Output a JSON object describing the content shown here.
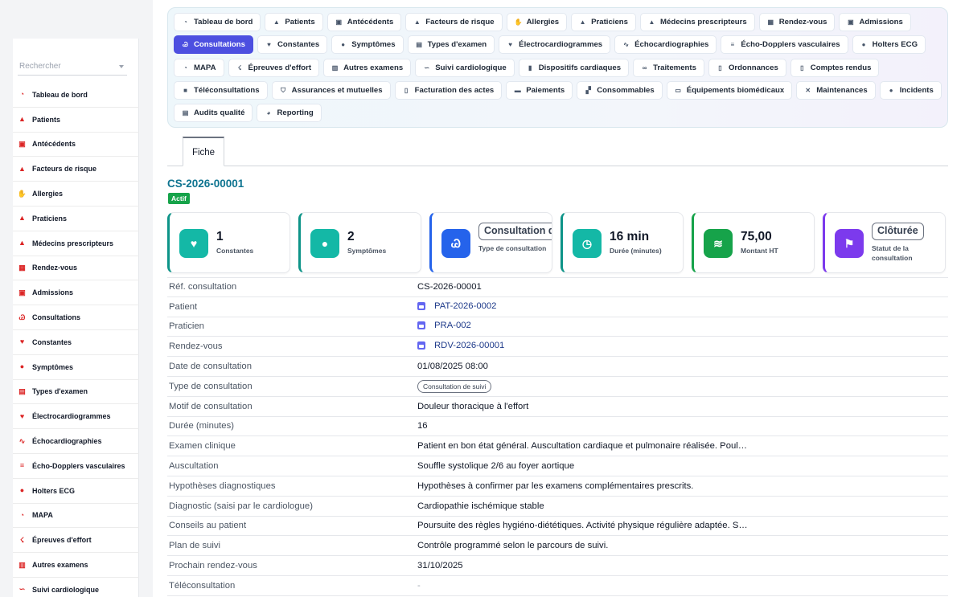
{
  "search": {
    "placeholder": "Rechercher"
  },
  "sidebar": {
    "items": [
      {
        "label": "Tableau de bord",
        "icon": "dashboard-icon",
        "glyph": "◔"
      },
      {
        "label": "Patients",
        "icon": "user-icon",
        "glyph": "▲"
      },
      {
        "label": "Antécédents",
        "icon": "clipboard-icon",
        "glyph": "▣"
      },
      {
        "label": "Facteurs de risque",
        "icon": "warning-icon",
        "glyph": "▲"
      },
      {
        "label": "Allergies",
        "icon": "hand-icon",
        "glyph": "✋"
      },
      {
        "label": "Praticiens",
        "icon": "doctor-icon",
        "glyph": "▲"
      },
      {
        "label": "Médecins prescripteurs",
        "icon": "doctor-icon",
        "glyph": "▲"
      },
      {
        "label": "Rendez-vous",
        "icon": "calendar-icon",
        "glyph": "▦"
      },
      {
        "label": "Admissions",
        "icon": "clipboard-check-icon",
        "glyph": "▣"
      },
      {
        "label": "Consultations",
        "icon": "stethoscope-icon",
        "glyph": "Ꮚ"
      },
      {
        "label": "Constantes",
        "icon": "heart-pulse-icon",
        "glyph": "♥"
      },
      {
        "label": "Symptômes",
        "icon": "head-icon",
        "glyph": "●"
      },
      {
        "label": "Types d'examen",
        "icon": "list-icon",
        "glyph": "▤"
      },
      {
        "label": "Électrocardiogrammes",
        "icon": "heart-icon",
        "glyph": "♥"
      },
      {
        "label": "Échocardiographies",
        "icon": "wave-icon",
        "glyph": "∿"
      },
      {
        "label": "Écho-Dopplers vasculaires",
        "icon": "lines-icon",
        "glyph": "≡"
      },
      {
        "label": "Holters ECG",
        "icon": "clock-icon",
        "glyph": "●"
      },
      {
        "label": "MAPA",
        "icon": "gauge-icon",
        "glyph": "◔"
      },
      {
        "label": "Épreuves d'effort",
        "icon": "running-icon",
        "glyph": "☇"
      },
      {
        "label": "Autres examens",
        "icon": "building-icon",
        "glyph": "▥"
      },
      {
        "label": "Suivi cardiologique",
        "icon": "route-icon",
        "glyph": "∽"
      }
    ]
  },
  "nav": {
    "buttons": [
      {
        "label": "Tableau de bord",
        "icon": "dashboard-icon",
        "glyph": "◔"
      },
      {
        "label": "Patients",
        "icon": "user-icon",
        "glyph": "▲"
      },
      {
        "label": "Antécédents",
        "icon": "clipboard-icon",
        "glyph": "▣"
      },
      {
        "label": "Facteurs de risque",
        "icon": "warning-icon",
        "glyph": "▲"
      },
      {
        "label": "Allergies",
        "icon": "hand-icon",
        "glyph": "✋"
      },
      {
        "label": "Praticiens",
        "icon": "doctor-icon",
        "glyph": "▲"
      },
      {
        "label": "Médecins prescripteurs",
        "icon": "doctor-icon",
        "glyph": "▲"
      },
      {
        "label": "Rendez-vous",
        "icon": "calendar-icon",
        "glyph": "▦"
      },
      {
        "label": "Admissions",
        "icon": "clipboard-check-icon",
        "glyph": "▣"
      },
      {
        "label": "Consultations",
        "icon": "stethoscope-icon",
        "glyph": "Ꮚ",
        "active": true
      },
      {
        "label": "Constantes",
        "icon": "heart-pulse-icon",
        "glyph": "♥"
      },
      {
        "label": "Symptômes",
        "icon": "head-icon",
        "glyph": "●"
      },
      {
        "label": "Types d'examen",
        "icon": "list-icon",
        "glyph": "▤"
      },
      {
        "label": "Électrocardiogrammes",
        "icon": "heart-icon",
        "glyph": "♥"
      },
      {
        "label": "Échocardiographies",
        "icon": "wave-icon",
        "glyph": "∿"
      },
      {
        "label": "Écho-Dopplers vasculaires",
        "icon": "lines-icon",
        "glyph": "≡"
      },
      {
        "label": "Holters ECG",
        "icon": "clock-icon",
        "glyph": "●"
      },
      {
        "label": "MAPA",
        "icon": "gauge-icon",
        "glyph": "◔"
      },
      {
        "label": "Épreuves d'effort",
        "icon": "running-icon",
        "glyph": "☇"
      },
      {
        "label": "Autres examens",
        "icon": "building-icon",
        "glyph": "▥"
      },
      {
        "label": "Suivi cardiologique",
        "icon": "route-icon",
        "glyph": "∽"
      },
      {
        "label": "Dispositifs cardiaques",
        "icon": "device-icon",
        "glyph": "▮"
      },
      {
        "label": "Traitements",
        "icon": "pills-icon",
        "glyph": "∞"
      },
      {
        "label": "Ordonnances",
        "icon": "prescription-icon",
        "glyph": "▯"
      },
      {
        "label": "Comptes rendus",
        "icon": "document-icon",
        "glyph": "▯"
      },
      {
        "label": "Téléconsultations",
        "icon": "video-icon",
        "glyph": "■"
      },
      {
        "label": "Assurances et mutuelles",
        "icon": "shield-icon",
        "glyph": "⛉"
      },
      {
        "label": "Facturation des actes",
        "icon": "invoice-icon",
        "glyph": "▯"
      },
      {
        "label": "Paiements",
        "icon": "card-icon",
        "glyph": "▬"
      },
      {
        "label": "Consommables",
        "icon": "boxes-icon",
        "glyph": "▞"
      },
      {
        "label": "Équipements biomédicaux",
        "icon": "monitor-icon",
        "glyph": "▭"
      },
      {
        "label": "Maintenances",
        "icon": "tools-icon",
        "glyph": "✕"
      },
      {
        "label": "Incidents",
        "icon": "alert-circle-icon",
        "glyph": "●"
      },
      {
        "label": "Audits qualité",
        "icon": "clipboard-list-icon",
        "glyph": "▤"
      },
      {
        "label": "Reporting",
        "icon": "pie-chart-icon",
        "glyph": "◕"
      }
    ]
  },
  "tabs": {
    "fiche": "Fiche"
  },
  "record": {
    "id": "CS-2026-00001",
    "status": "Actif"
  },
  "stats": [
    {
      "value": "1",
      "label": "Constantes",
      "icon": "heart-pulse-icon",
      "glyph": "♥",
      "color": "#14b8a6",
      "accent": "#0d9488"
    },
    {
      "value": "2",
      "label": "Symptômes",
      "icon": "head-icon",
      "glyph": "●",
      "color": "#14b8a6",
      "accent": "#0d9488"
    },
    {
      "value": "Consultation de suivi",
      "label": "Type de consultation",
      "icon": "stethoscope-icon",
      "glyph": "Ꮚ",
      "color": "#2563eb",
      "accent": "#2563eb",
      "boxed": true
    },
    {
      "value": "16 min",
      "label": "Durée (minutes)",
      "icon": "clock-icon",
      "glyph": "◷",
      "color": "#14b8a6",
      "accent": "#0d9488"
    },
    {
      "value": "75,00",
      "label": "Montant HT",
      "icon": "coins-icon",
      "glyph": "≋",
      "color": "#16a34a",
      "accent": "#16a34a"
    },
    {
      "value": "Clôturée",
      "label": "Statut de la consultation",
      "icon": "flag-icon",
      "glyph": "⚑",
      "color": "#7c3aed",
      "accent": "#7c3aed",
      "boxed": true
    }
  ],
  "details": [
    {
      "label": "Réf. consultation",
      "value": "CS-2026-00001"
    },
    {
      "label": "Patient",
      "value": "PAT-2026-0002",
      "link": true
    },
    {
      "label": "Praticien",
      "value": "PRA-002",
      "link": true
    },
    {
      "label": "Rendez-vous",
      "value": "RDV-2026-00001",
      "link": true
    },
    {
      "label": "Date de consultation",
      "value": "01/08/2025 08:00"
    },
    {
      "label": "Type de consultation",
      "value": "Consultation de suivi",
      "chip": true
    },
    {
      "label": "Motif de consultation",
      "value": "Douleur thoracique à l'effort"
    },
    {
      "label": "Durée (minutes)",
      "value": "16"
    },
    {
      "label": "Examen clinique",
      "value": "Patient en bon état général. Auscultation cardiaque et pulmonaire réalisée. Poul…"
    },
    {
      "label": "Auscultation",
      "value": "Souffle systolique 2/6 au foyer aortique"
    },
    {
      "label": "Hypothèses diagnostiques",
      "value": "Hypothèses à confirmer par les examens complémentaires prescrits."
    },
    {
      "label": "Diagnostic (saisi par le cardiologue)",
      "value": "Cardiopathie ischémique stable"
    },
    {
      "label": "Conseils au patient",
      "value": "Poursuite des règles hygiéno-diététiques. Activité physique régulière adaptée. S…"
    },
    {
      "label": "Plan de suivi",
      "value": "Contrôle programmé selon le parcours de suivi."
    },
    {
      "label": "Prochain rendez-vous",
      "value": "31/10/2025"
    },
    {
      "label": "Téléconsultation",
      "value": "-",
      "muted": true
    }
  ]
}
